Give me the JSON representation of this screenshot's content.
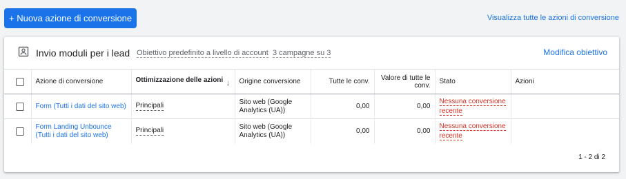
{
  "toolbar": {
    "new_action_label": "+ Nuova azione di conversione",
    "view_all_label": "Visualizza tutte le azioni di conversione"
  },
  "card": {
    "title": "Invio moduli per i lead",
    "goal_label": "Obiettivo predefinito a livello di account",
    "campaigns_label": "3 campagne su 3",
    "edit_label": "Modifica obiettivo",
    "icon": "form-icon"
  },
  "table": {
    "headers": {
      "action": "Azione di conversione",
      "optimization": "Ottimizzazione delle azioni",
      "origin": "Origine conversione",
      "all_conv": "Tutte le conv.",
      "all_value": "Valore di tutte le conv.",
      "status": "Stato",
      "actions": "Azioni"
    },
    "rows": [
      {
        "action": "Form (Tutti i dati del sito web)",
        "optimization": "Principali",
        "origin": "Sito web (Google Analytics (UA))",
        "all_conv": "0,00",
        "all_value": "0,00",
        "status_line1": "Nessuna conversione",
        "status_line2": "recente"
      },
      {
        "action": "Form Landing Unbounce (Tutti i dati del sito web)",
        "optimization": "Principali",
        "origin": "Sito web (Google Analytics (UA))",
        "all_conv": "0,00",
        "all_value": "0,00",
        "status_line1": "Nessuna conversione",
        "status_line2": "recente"
      }
    ]
  },
  "pagination": {
    "label": "1 - 2 di 2"
  },
  "colors": {
    "accent": "#1a73e8",
    "warning": "#d93025"
  }
}
